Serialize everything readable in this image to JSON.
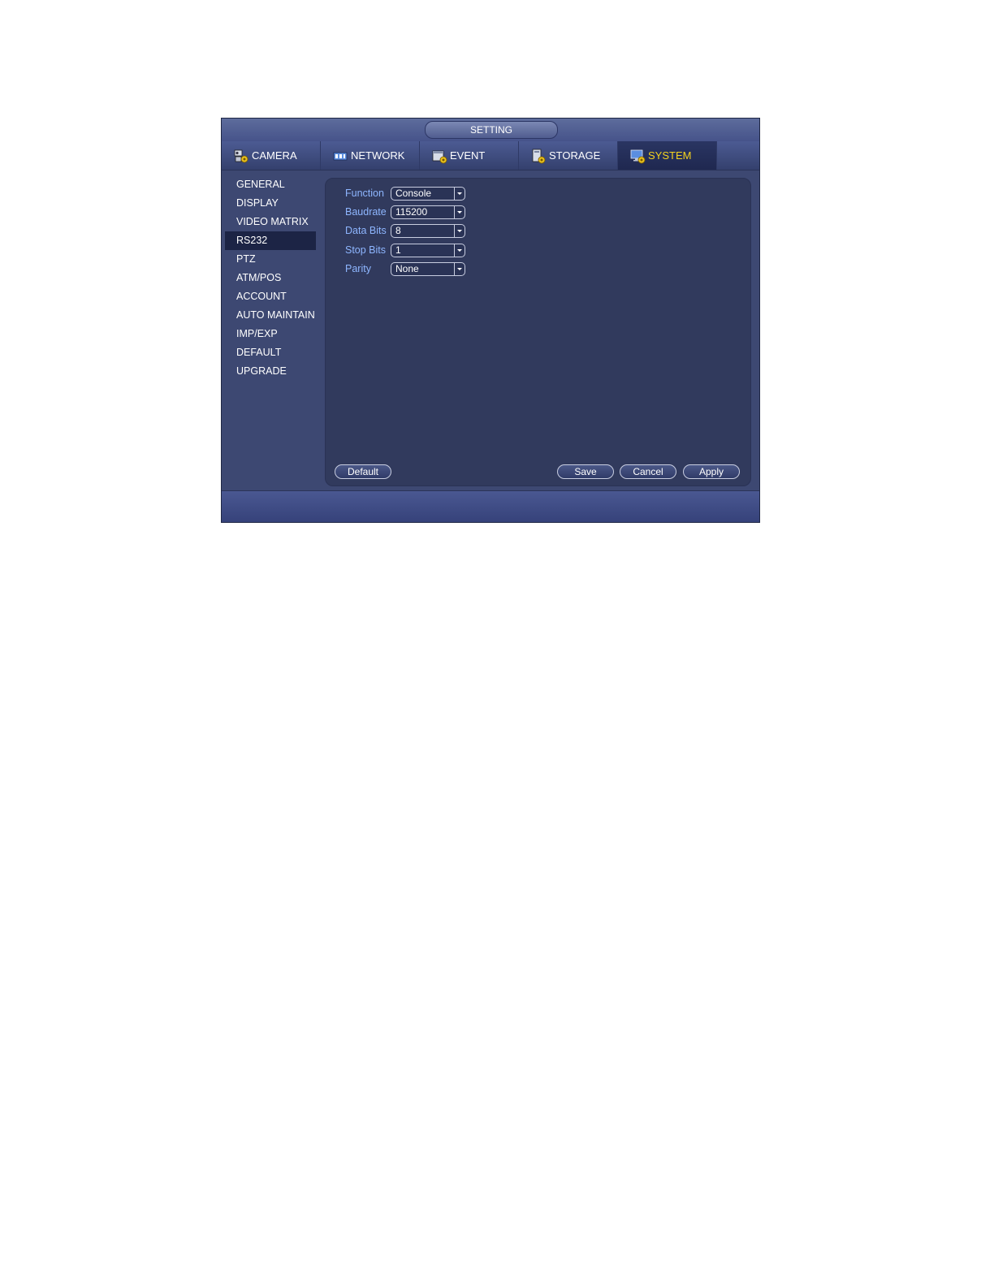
{
  "window": {
    "title": "SETTING"
  },
  "tabs": [
    {
      "label": "CAMERA",
      "icon": "camera-icon"
    },
    {
      "label": "NETWORK",
      "icon": "network-icon"
    },
    {
      "label": "EVENT",
      "icon": "event-icon"
    },
    {
      "label": "STORAGE",
      "icon": "storage-icon"
    },
    {
      "label": "SYSTEM",
      "icon": "system-icon",
      "active": true
    }
  ],
  "sidebar": {
    "items": [
      {
        "label": "GENERAL"
      },
      {
        "label": "DISPLAY"
      },
      {
        "label": "VIDEO MATRIX"
      },
      {
        "label": "RS232",
        "active": true
      },
      {
        "label": "PTZ"
      },
      {
        "label": "ATM/POS"
      },
      {
        "label": "ACCOUNT"
      },
      {
        "label": "AUTO MAINTAIN"
      },
      {
        "label": "IMP/EXP"
      },
      {
        "label": "DEFAULT"
      },
      {
        "label": "UPGRADE"
      }
    ]
  },
  "form": {
    "function": {
      "label": "Function",
      "value": "Console"
    },
    "baudrate": {
      "label": "Baudrate",
      "value": "115200"
    },
    "data_bits": {
      "label": "Data Bits",
      "value": "8"
    },
    "stop_bits": {
      "label": "Stop Bits",
      "value": "1"
    },
    "parity": {
      "label": "Parity",
      "value": "None"
    }
  },
  "buttons": {
    "default": "Default",
    "save": "Save",
    "cancel": "Cancel",
    "apply": "Apply"
  },
  "colors": {
    "active_tab_text": "#f4d21e",
    "field_label": "#8eb6ff",
    "panel_bg": "#313a5d"
  }
}
